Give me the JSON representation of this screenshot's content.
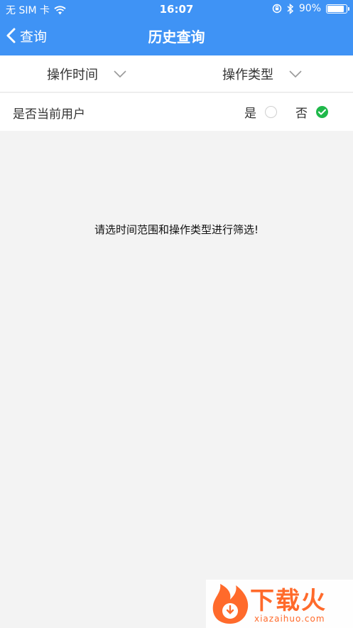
{
  "status_bar": {
    "carrier": "无 SIM 卡",
    "time": "16:07",
    "battery_percent": "90%",
    "battery_level": 0.9
  },
  "nav": {
    "back_label": "查询",
    "title": "历史查询"
  },
  "filters": {
    "time_label": "操作时间",
    "type_label": "操作类型"
  },
  "current_user": {
    "label": "是否当前用户",
    "yes_label": "是",
    "no_label": "否",
    "selected": "否"
  },
  "empty_hint": "请选时间范围和操作类型进行筛选!",
  "watermark": {
    "brand": "下载火",
    "url": "xiazaihuo.com"
  },
  "colors": {
    "header_blue": "#3f93f5",
    "check_green": "#1fb84a",
    "background": "#f3f3f3",
    "watermark_orange": "#ff6a2b"
  }
}
